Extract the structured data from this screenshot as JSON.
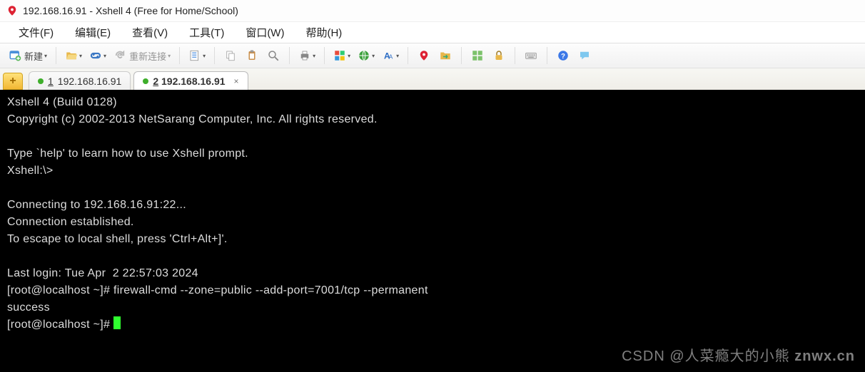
{
  "window": {
    "title": "192.168.16.91 - Xshell 4 (Free for Home/School)"
  },
  "menu": {
    "file": "文件(F)",
    "edit": "编辑(E)",
    "view": "查看(V)",
    "tools": "工具(T)",
    "window": "窗口(W)",
    "help": "帮助(H)"
  },
  "toolbar": {
    "new_label": "新建",
    "reconnect_label": "重新连接"
  },
  "tabs": {
    "t1_num": "1",
    "t1_label": "192.168.16.91",
    "t2_num": "2",
    "t2_label": "192.168.16.91",
    "close_glyph": "×",
    "plus_glyph": "+"
  },
  "terminal": {
    "l01": "Xshell 4 (Build 0128)",
    "l02": "Copyright (c) 2002-2013 NetSarang Computer, Inc. All rights reserved.",
    "l03": "",
    "l04": "Type `help' to learn how to use Xshell prompt.",
    "l05": "Xshell:\\>",
    "l06": "",
    "l07": "Connecting to 192.168.16.91:22...",
    "l08": "Connection established.",
    "l09": "To escape to local shell, press 'Ctrl+Alt+]'.",
    "l10": "",
    "l11": "Last login: Tue Apr  2 22:57:03 2024",
    "l12": "[root@localhost ~]# firewall-cmd --zone=public --add-port=7001/tcp --permanent",
    "l13": "success",
    "l14": "[root@localhost ~]# "
  },
  "watermark": {
    "csdn": "CSDN @人菜瘾大的小熊",
    "brand": "znwx.cn"
  }
}
